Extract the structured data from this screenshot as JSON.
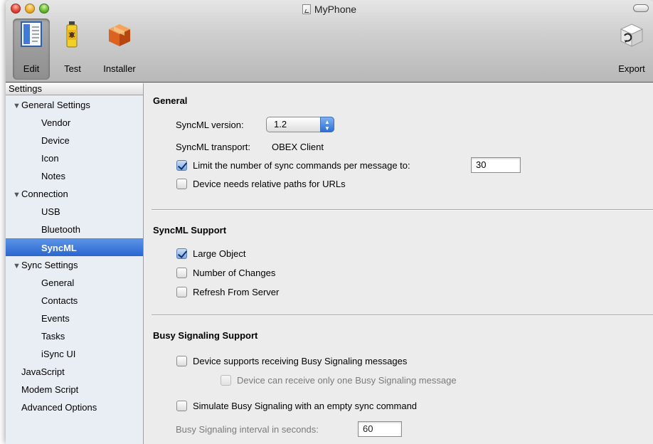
{
  "window": {
    "title": "MyPhone"
  },
  "toolbar": {
    "edit_label": "Edit",
    "test_label": "Test",
    "installer_label": "Installer",
    "export_label": "Export"
  },
  "sidebar": {
    "header": "Settings",
    "items": [
      {
        "label": "General Settings",
        "disclosure": "▼"
      },
      {
        "label": "Vendor"
      },
      {
        "label": "Device"
      },
      {
        "label": "Icon"
      },
      {
        "label": "Notes"
      },
      {
        "label": "Connection",
        "disclosure": "▼"
      },
      {
        "label": "USB"
      },
      {
        "label": "Bluetooth"
      },
      {
        "label": "SyncML",
        "selected": true
      },
      {
        "label": "Sync Settings",
        "disclosure": "▼"
      },
      {
        "label": "General"
      },
      {
        "label": "Contacts"
      },
      {
        "label": "Events"
      },
      {
        "label": "Tasks"
      },
      {
        "label": "iSync UI"
      },
      {
        "label": "JavaScript"
      },
      {
        "label": "Modem Script"
      },
      {
        "label": "Advanced Options"
      }
    ]
  },
  "general": {
    "title": "General",
    "version_label": "SyncML version:",
    "version_value": "1.2",
    "transport_label": "SyncML transport:",
    "transport_value": "OBEX Client",
    "limit_label": "Limit the number of sync commands per message to:",
    "limit_checked": true,
    "limit_value": "30",
    "relative_paths_label": "Device needs relative paths for URLs",
    "relative_paths_checked": false
  },
  "syncml_support": {
    "title": "SyncML Support",
    "large_object_label": "Large Object",
    "large_object_checked": true,
    "num_changes_label": "Number of Changes",
    "num_changes_checked": false,
    "refresh_label": "Refresh From Server",
    "refresh_checked": false
  },
  "busy": {
    "title": "Busy Signaling Support",
    "receive_label": "Device supports receiving Busy Signaling messages",
    "receive_checked": false,
    "only_one_label": "Device can receive only one Busy Signaling message",
    "only_one_checked": false,
    "simulate_label": "Simulate Busy Signaling with an empty sync command",
    "simulate_checked": false,
    "interval_label": "Busy Signaling interval in seconds:",
    "interval_value": "60"
  },
  "colors": {
    "selection": "#2a66cf",
    "sidebar_bg": "#e9eef5"
  }
}
